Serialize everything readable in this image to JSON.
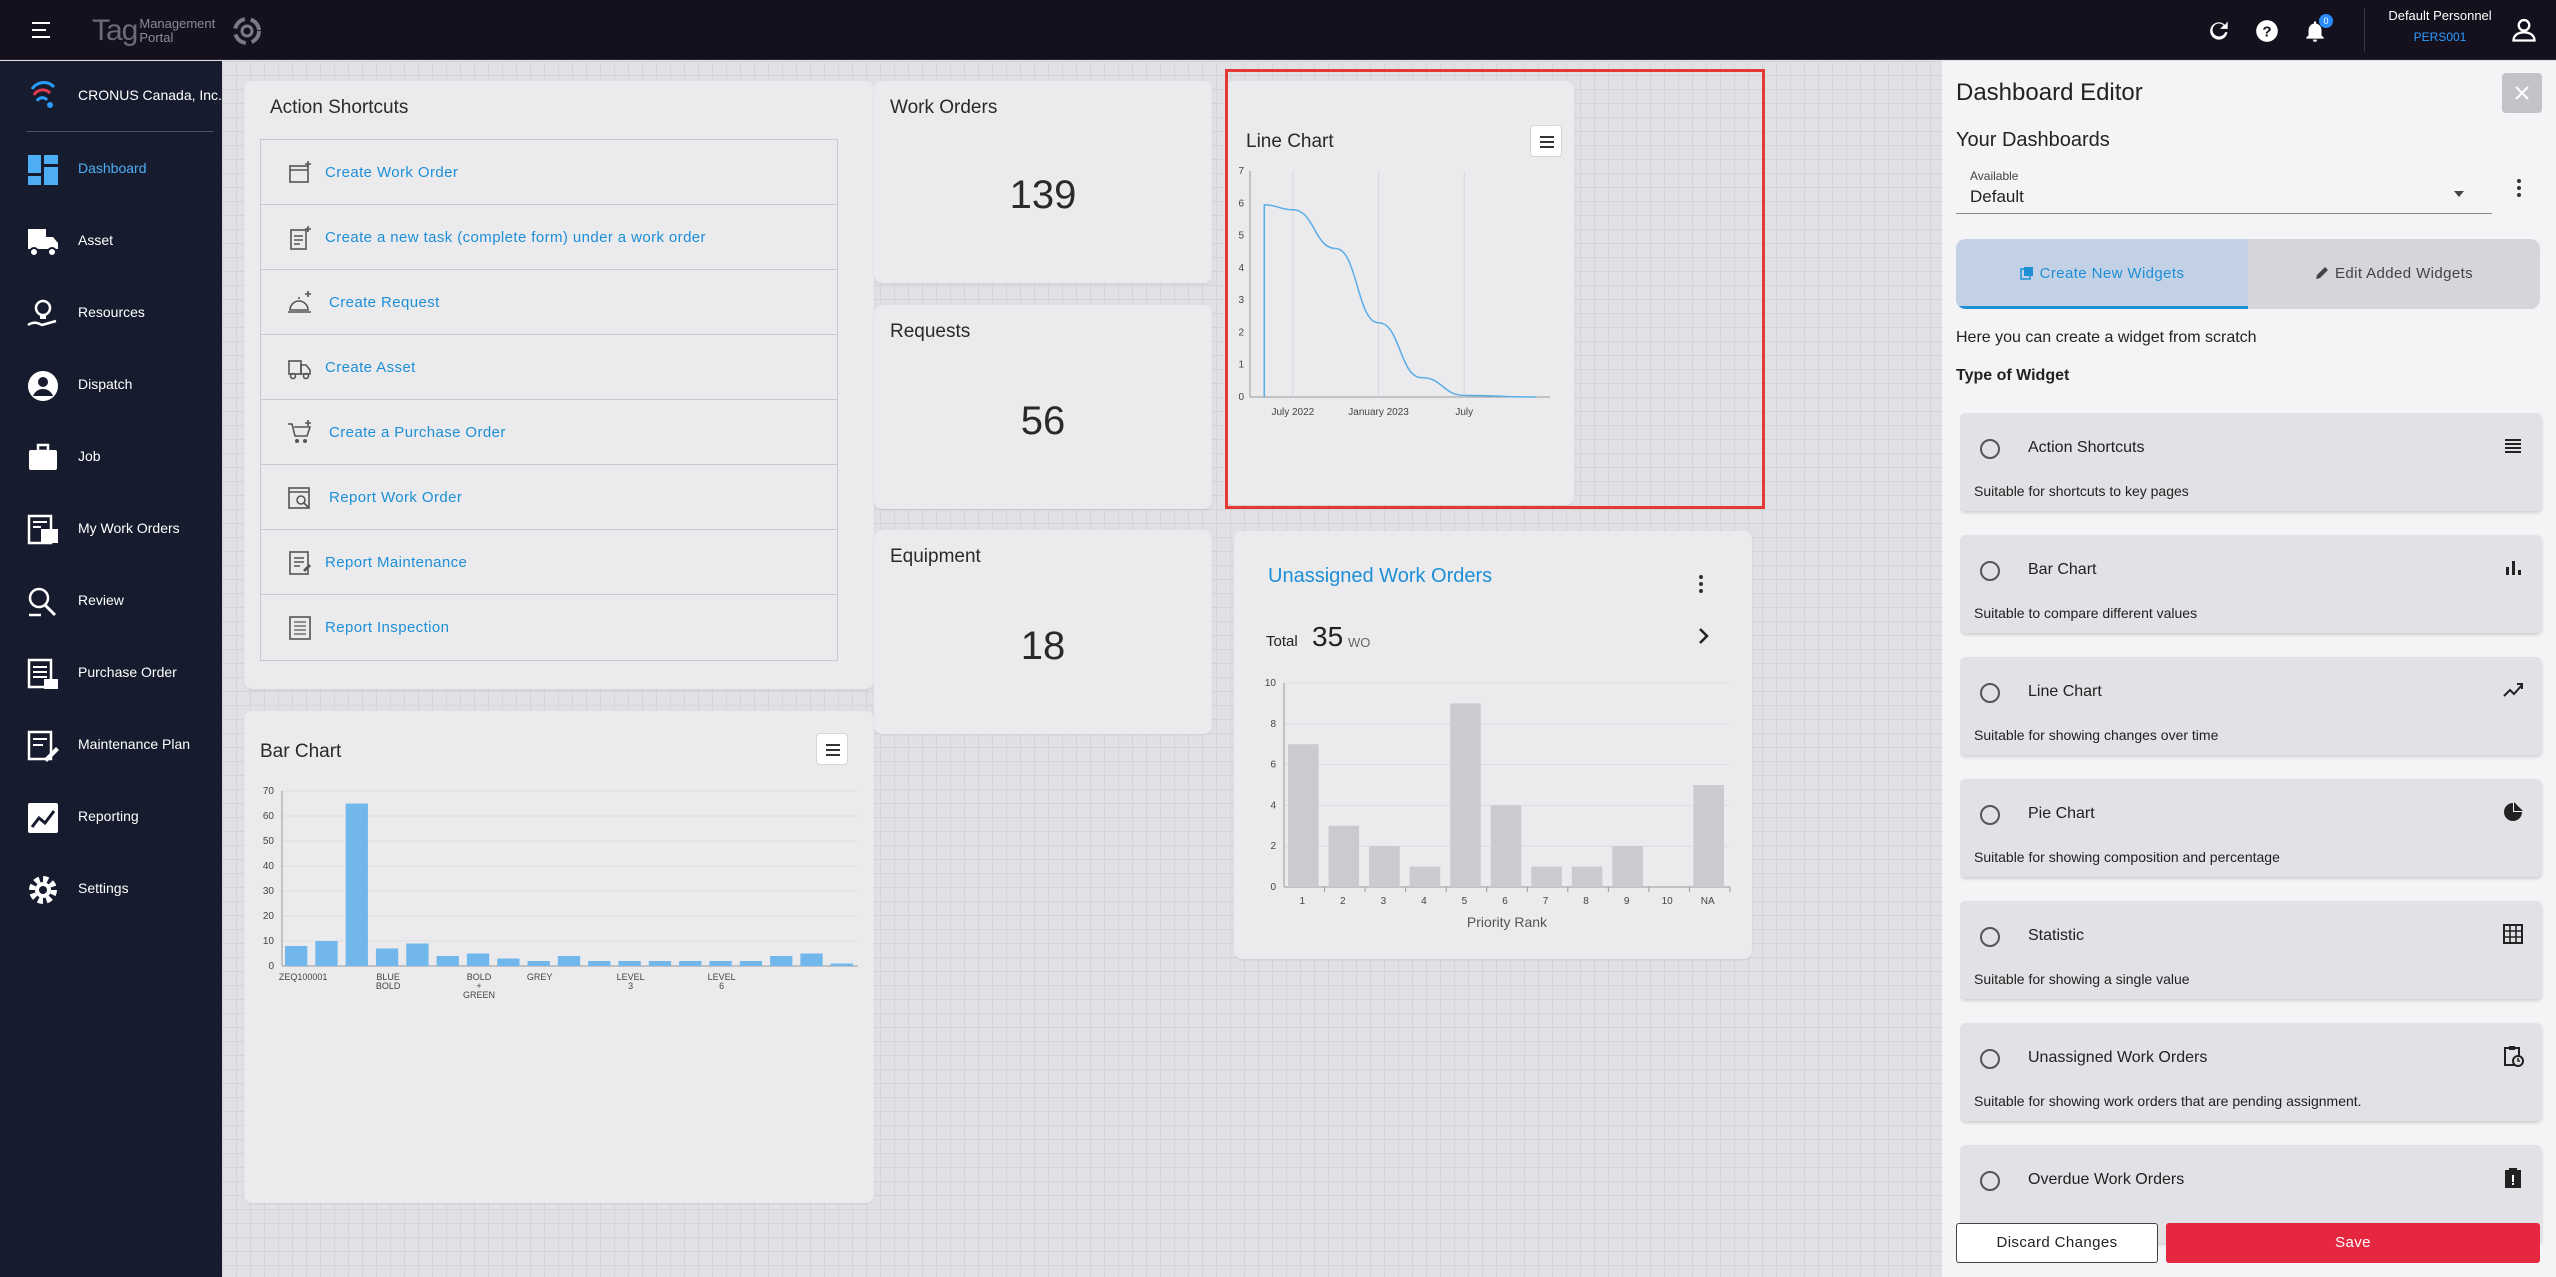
{
  "topbar": {
    "brand_tag": "Tag",
    "brand_management": "Management",
    "brand_portal": "Portal",
    "notification_count": "0",
    "user_name": "Default Personnel",
    "user_code": "PERS001"
  },
  "sidebar": {
    "company": "CRONUS Canada, Inc.",
    "items": [
      {
        "label": "Dashboard",
        "icon": "dashboard-icon",
        "active": true
      },
      {
        "label": "Asset",
        "icon": "truck-icon"
      },
      {
        "label": "Resources",
        "icon": "lightbulb-hand-icon"
      },
      {
        "label": "Dispatch",
        "icon": "person-circle-icon"
      },
      {
        "label": "Job",
        "icon": "briefcase-icon"
      },
      {
        "label": "My Work Orders",
        "icon": "work-orders-icon"
      },
      {
        "label": "Review",
        "icon": "review-icon"
      },
      {
        "label": "Purchase Order",
        "icon": "purchase-order-icon"
      },
      {
        "label": "Maintenance Plan",
        "icon": "maintenance-plan-icon"
      },
      {
        "label": "Reporting",
        "icon": "chart-line-icon"
      },
      {
        "label": "Settings",
        "icon": "gear-icon"
      }
    ]
  },
  "action_shortcuts": {
    "title": "Action Shortcuts",
    "items": [
      {
        "label": "Create Work Order",
        "icon": "create-work-order-icon"
      },
      {
        "label": "Create a new task (complete form) under a work order",
        "icon": "clipboard-add-icon"
      },
      {
        "label": "Create Request",
        "icon": "service-bell-icon"
      },
      {
        "label": "Create Asset",
        "icon": "truck-add-icon"
      },
      {
        "label": "Create a Purchase Order",
        "icon": "cart-add-icon"
      },
      {
        "label": "Report Work Order",
        "icon": "report-search-icon"
      },
      {
        "label": "Report Maintenance",
        "icon": "report-list-icon"
      },
      {
        "label": "Report Inspection",
        "icon": "report-inspection-icon"
      }
    ]
  },
  "stats": {
    "work_orders": {
      "title": "Work Orders",
      "value": "139"
    },
    "requests": {
      "title": "Requests",
      "value": "56"
    },
    "equipment": {
      "title": "Equipment",
      "value": "18"
    }
  },
  "line_chart_widget": {
    "title": "Line Chart",
    "highlight_color": "#e53935"
  },
  "bar_chart_widget": {
    "title": "Bar Chart"
  },
  "unassigned": {
    "title": "Unassigned Work Orders",
    "total_label": "Total",
    "total_value": "35",
    "total_unit": "WO"
  },
  "chart_data": [
    {
      "type": "line",
      "title": "Line Chart",
      "x_ticks": [
        "July 2022",
        "January 2023",
        "July"
      ],
      "ylim": [
        0,
        7
      ],
      "y_ticks": [
        0,
        1,
        2,
        3,
        4,
        5,
        6,
        7
      ],
      "series": [
        {
          "color": "#5aaee8",
          "x": [
            "2022-05",
            "2022-05",
            "2022-07",
            "2022-10",
            "2023-01",
            "2023-04",
            "2023-07",
            "2023-12"
          ],
          "y": [
            0,
            5.95,
            5.8,
            4.6,
            2.3,
            0.6,
            0.05,
            0
          ]
        }
      ],
      "grid": true
    },
    {
      "type": "bar",
      "title": "Bar Chart",
      "ylim": [
        0,
        70
      ],
      "y_ticks": [
        0,
        10,
        20,
        30,
        40,
        50,
        60,
        70
      ],
      "x_tick_labels": [
        "ZEQ100001",
        "BLUE BOLD",
        "BOLD + GREEN",
        "GREY",
        "LEVEL 3",
        "LEVEL 6"
      ],
      "values": [
        8,
        10,
        65,
        7,
        9,
        4,
        5,
        3,
        2,
        4,
        2,
        2,
        2,
        2,
        2,
        2,
        4,
        5,
        1
      ],
      "color": "#72b7ec",
      "grid": true
    },
    {
      "type": "bar",
      "title": "",
      "xlabel": "Priority Rank",
      "categories": [
        "1",
        "2",
        "3",
        "4",
        "5",
        "6",
        "7",
        "8",
        "9",
        "10",
        "NA"
      ],
      "values": [
        7,
        3,
        2,
        1,
        9,
        4,
        1,
        1,
        2,
        0,
        5
      ],
      "ylim": [
        0,
        10
      ],
      "y_ticks": [
        0,
        2,
        4,
        6,
        8,
        10
      ],
      "color": "#cacacf",
      "grid": true
    }
  ],
  "editor": {
    "title": "Dashboard Editor",
    "subtitle": "Your Dashboards",
    "select_label": "Available",
    "select_value": "Default",
    "tab_create": "Create New Widgets",
    "tab_edit": "Edit Added Widgets",
    "description": "Here you can create a widget from scratch",
    "type_heading": "Type of Widget",
    "widgets": [
      {
        "name": "Action Shortcuts",
        "desc": "Suitable for shortcuts to key pages",
        "icon": "list-icon"
      },
      {
        "name": "Bar Chart",
        "desc": "Suitable to compare different values",
        "icon": "bar-chart-icon"
      },
      {
        "name": "Line Chart",
        "desc": "Suitable for showing changes over time",
        "icon": "trend-line-icon"
      },
      {
        "name": "Pie Chart",
        "desc": "Suitable for showing composition and percentage",
        "icon": "pie-chart-icon"
      },
      {
        "name": "Statistic",
        "desc": "Suitable for showing a single value",
        "icon": "grid-icon"
      },
      {
        "name": "Unassigned Work Orders",
        "desc": "Suitable for showing work orders that are pending assignment.",
        "icon": "clipboard-clock-icon"
      },
      {
        "name": "Overdue Work Orders",
        "desc": "",
        "icon": "clipboard-alert-icon"
      }
    ],
    "discard_label": "Discard Changes",
    "save_label": "Save",
    "save_color": "#e5273f"
  }
}
